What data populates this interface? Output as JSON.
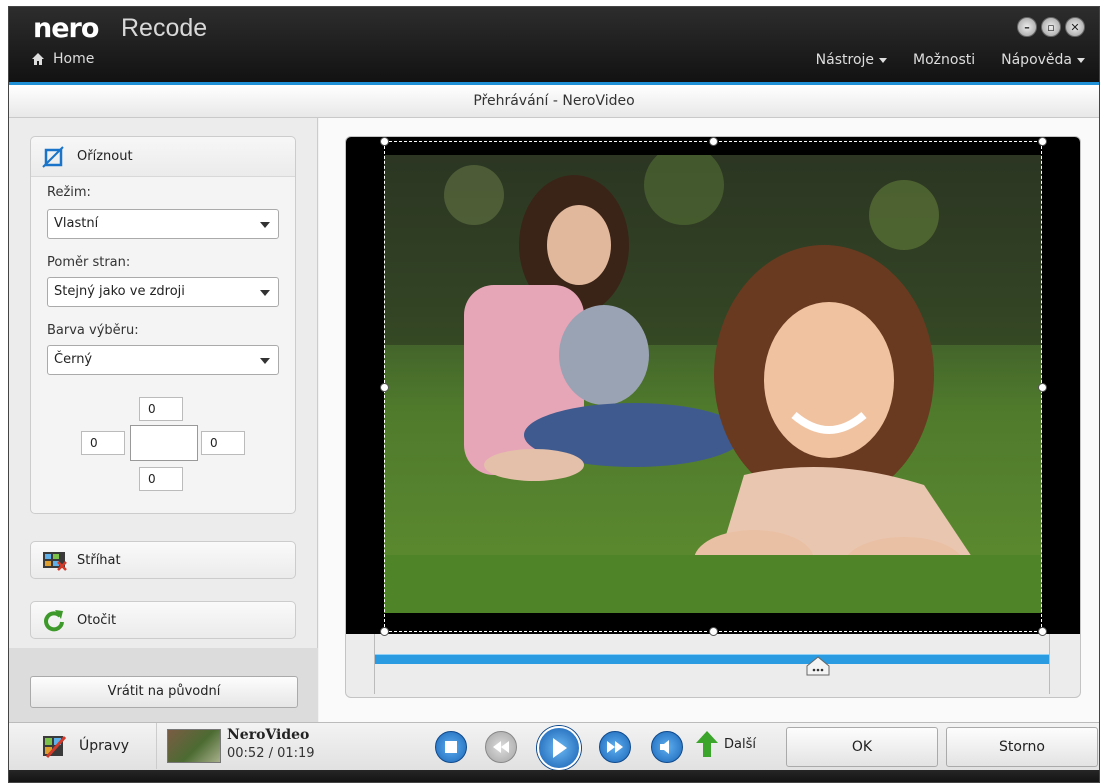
{
  "app": {
    "brand": "nero",
    "name": "Recode"
  },
  "nav": {
    "home": "Home",
    "menus": [
      "Nástroje",
      "Možnosti",
      "Nápověda"
    ]
  },
  "window_controls": [
    "minimize",
    "restore",
    "close"
  ],
  "subheader": {
    "title": "Přehrávání - NeroVideo"
  },
  "crop_panel": {
    "title": "Oříznout",
    "mode_label": "Režim:",
    "mode_value": "Vlastní",
    "aspect_label": "Poměr stran:",
    "aspect_value": "Stejný jako ve zdroji",
    "color_label": "Barva výběru:",
    "color_value": "Černý",
    "margins": {
      "top": "0",
      "left": "0",
      "right": "0",
      "bottom": "0"
    }
  },
  "tools": {
    "cut": "Stříhat",
    "rotate": "Otočit"
  },
  "reset_button": "Vrátit na původní",
  "bottom": {
    "edits_label": "Úpravy",
    "clip_name": "NeroVideo",
    "clip_time": "00:52 / 01:19",
    "next_label": "Další",
    "ok": "OK",
    "cancel": "Storno"
  },
  "colors": {
    "accent": "#1f8fd6",
    "titlebar": "#1a1a1a",
    "playback_blue": "#1e7fd0"
  }
}
